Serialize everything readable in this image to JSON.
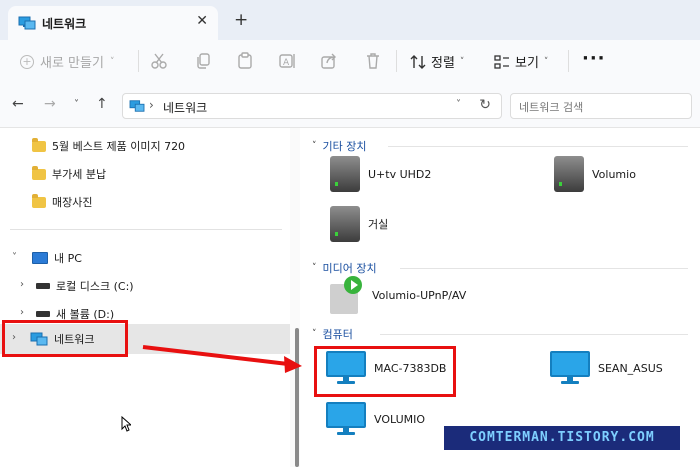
{
  "window": {
    "tab_title": "네트워크",
    "new_tab_label": "+",
    "close_label": "✕"
  },
  "commandbar": {
    "new_label": "새로 만들기",
    "sort_label": "정렬",
    "view_label": "보기",
    "more_label": "···"
  },
  "address": {
    "path": "네트워크",
    "search_placeholder": "네트워크 검색"
  },
  "sidebar": {
    "folders": [
      "5월 베스트 제품 이미지 720",
      "부가세 분납",
      "매장사진"
    ],
    "this_pc": "내 PC",
    "drives": [
      "로컬 디스크 (C:)",
      "새 볼륨 (D:)"
    ],
    "network": "네트워크"
  },
  "main": {
    "groups": {
      "other": "기타 장치",
      "media": "미디어 장치",
      "computer": "컴퓨터"
    },
    "other_devices": [
      "U+tv UHD2",
      "Volumio",
      "거실"
    ],
    "media_devices": [
      "Volumio-UPnP/AV"
    ],
    "computers": [
      "MAC-7383DB",
      "SEAN_ASUS",
      "VOLUMIO"
    ]
  },
  "watermark": "COMTERMAN.TISTORY.COM",
  "colors": {
    "highlight": "#e81010",
    "group_header": "#1a4fa0",
    "selection": "#e6e6e6"
  }
}
